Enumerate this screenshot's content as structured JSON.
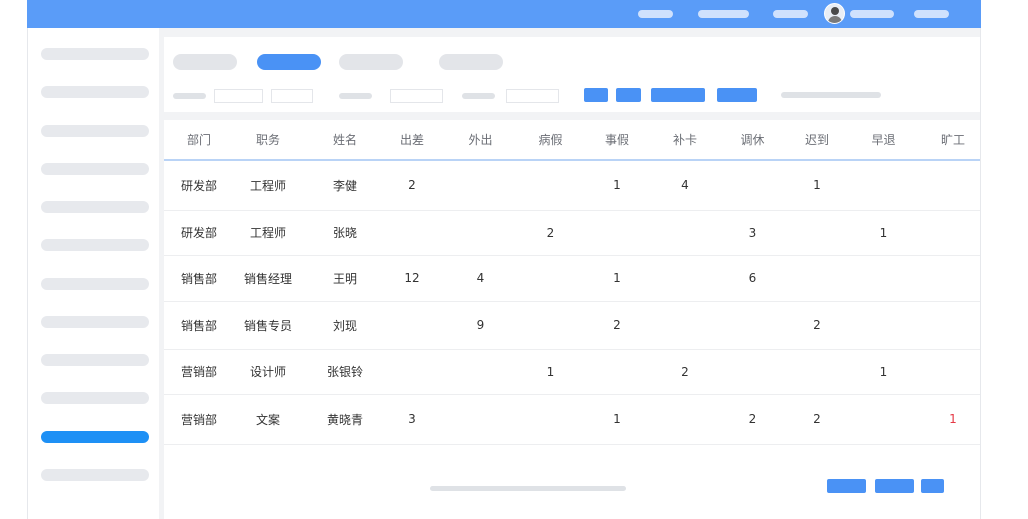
{
  "columns": [
    "部门",
    "职务",
    "姓名",
    "出差",
    "外出",
    "病假",
    "事假",
    "补卡",
    "调休",
    "迟到",
    "早退",
    "旷工"
  ],
  "rows": [
    [
      "研发部",
      "工程师",
      "李健",
      "2",
      "",
      "",
      "1",
      "4",
      "",
      "1",
      "",
      ""
    ],
    [
      "研发部",
      "工程师",
      "张晓",
      "",
      "",
      "2",
      "",
      "",
      "3",
      "",
      "1",
      ""
    ],
    [
      "销售部",
      "销售经理",
      "王明",
      "12",
      "4",
      "",
      "1",
      "",
      "6",
      "",
      "",
      ""
    ],
    [
      "销售部",
      "销售专员",
      "刘现",
      "",
      "9",
      "",
      "2",
      "",
      "",
      "2",
      "",
      ""
    ],
    [
      "营销部",
      "设计师",
      "张银铃",
      "",
      "",
      "1",
      "",
      "2",
      "",
      "",
      "1",
      ""
    ],
    [
      "营销部",
      "文案",
      "黄晓青",
      "3",
      "",
      "",
      "1",
      "",
      "2",
      "2",
      "",
      "1"
    ]
  ],
  "colors": {
    "topbar": "#5a9cf8",
    "accent": "#4a92f5",
    "sidebar_active": "#1e90f5",
    "absent_highlight": "#e53946"
  },
  "icons": {
    "avatar": "user-avatar-icon"
  }
}
